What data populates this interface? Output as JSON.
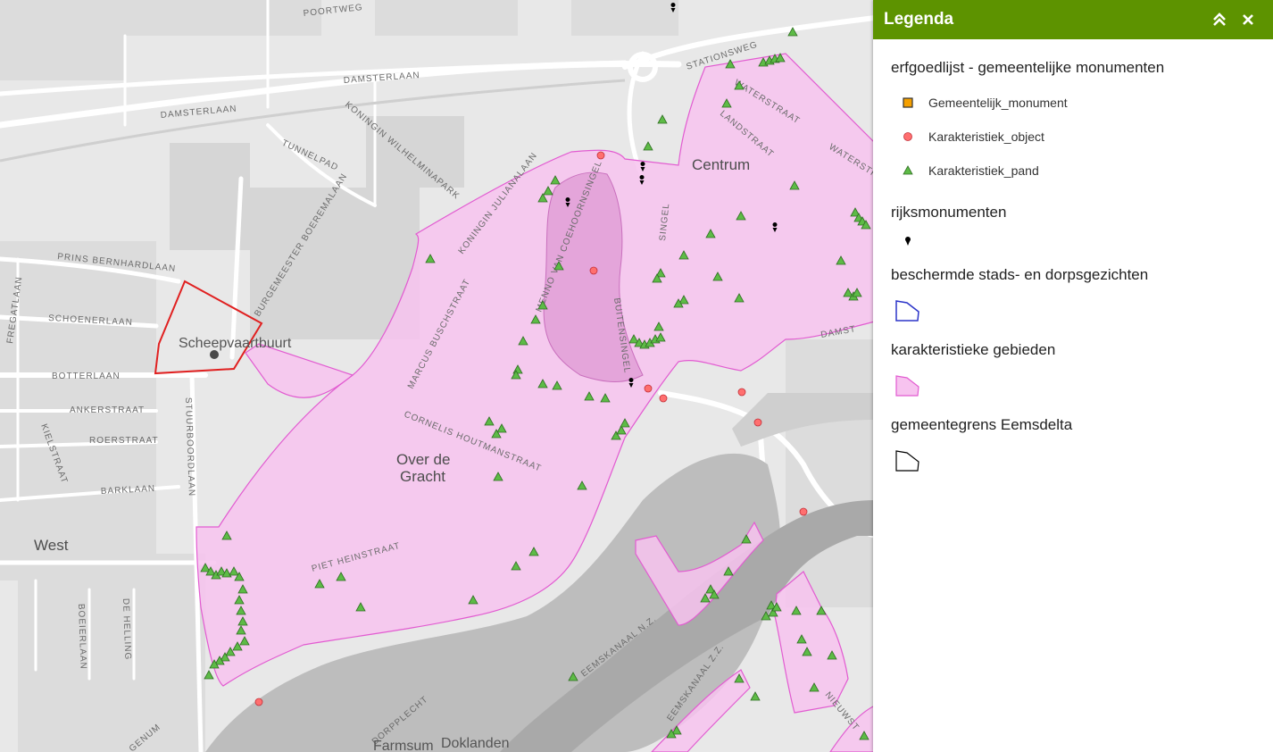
{
  "map": {
    "place_labels": {
      "scheepvaartbuurt": "Scheepvaartbuurt",
      "centrum": "Centrum",
      "over_de_gracht_1": "Over de",
      "over_de_gracht_2": "Gracht",
      "west": "West",
      "farmsum": "Farmsum",
      "doklanden": "Doklanden"
    },
    "street_labels": {
      "poortweg": "POORTWEG",
      "damsterlaan_1": "DAMSTERLAAN",
      "damsterlaan_2": "DAMSTERLAAN",
      "stationsweg": "STATIONSWEG",
      "koningin_wilhelminapark": "KONINGIN WILHELMINAPARK",
      "tunnelpad": "TUNNELPAD",
      "boeremalaan": "BURGEMEESTER BOEREMALAAN",
      "prins_bernhardlaan": "PRINS BERNHARDLAAN",
      "schoenerlaan": "SCHOENERLAAN",
      "fregatlaan": "FREGATLAAN",
      "botterlaan": "BOTTERLAAN",
      "ankerstraat": "ANKERSTRAAT",
      "kielstraat": "KIELSTRAAT",
      "roerstraat": "ROERSTRAAT",
      "barklaan": "BARKLAAN",
      "stuurboordlaan": "STUURBOORDLAAN",
      "julianalaan": "KONINGIN JULIANALAAN",
      "marcus_buschstraat": "MARCUS BUSCHSTRAAT",
      "menno_van_coehoornsingel": "MENNO VAN COEHOORNSINGEL",
      "singel": "SINGEL",
      "buitensingel": "BUITENSINGEL",
      "cornelis_houtmanstraat": "CORNELIS HOUTMANSTRAAT",
      "piet_heinstraat": "PIET HEINSTRAAT",
      "waterstraat_1": "WATERSTRAAT",
      "waterstraat_2": "WATERSTR",
      "landstraat": "LANDSTRAAT",
      "damsterlaan_3": "DAMST",
      "eemskanaal_nz": "EEMSKANAAL N.Z.",
      "eemskanaal_zz": "EEMSKANAAL Z.Z.",
      "nieuwstraat": "NIEUWST",
      "boeierlaan": "BOEIERLAAN",
      "de_helling": "DE HELLING",
      "genum": "GENUM",
      "dorpplecht": "DORPPLECHT"
    }
  },
  "legend": {
    "title": "Legenda",
    "layers": [
      {
        "title": "erfgoedlijst - gemeentelijke monumenten",
        "symbols": [
          {
            "label": "Gemeentelijk_monument",
            "icon": "orange-square-icon",
            "color": "#f5a000"
          },
          {
            "label": "Karakteristiek_object",
            "icon": "red-circle-icon",
            "color": "#ff6f6f"
          },
          {
            "label": "Karakteristiek_pand",
            "icon": "green-triangle-icon",
            "color": "#5dbb46"
          }
        ]
      },
      {
        "title": "rijksmonumenten",
        "icon": "black-marker-icon"
      },
      {
        "title": "beschermde stads- en dorpsgezichten",
        "icon": "blue-polygon-icon",
        "color": "#2c35c9"
      },
      {
        "title": "karakteristieke gebieden",
        "icon": "pink-polygon-icon",
        "color": "#f7c3ef"
      },
      {
        "title": "gemeentegrens Eemsdelta",
        "icon": "black-polygon-icon",
        "color": "#000000"
      }
    ]
  }
}
